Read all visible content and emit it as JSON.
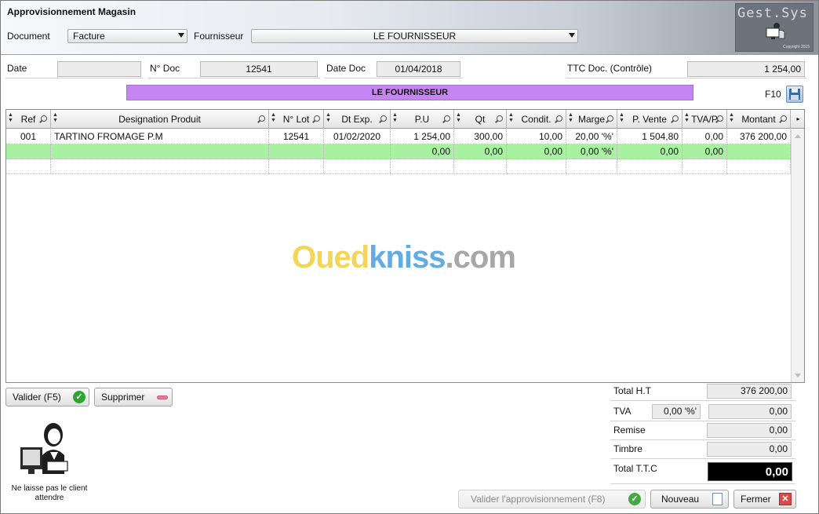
{
  "header": {
    "title": "Approvisionnement Magasin",
    "document_label": "Document",
    "document_value": "Facture",
    "fournisseur_label": "Fournisseur",
    "fournisseur_value": "LE FOURNISSEUR",
    "logo_text": "Gest.Sys",
    "logo_copyright": "Copyright 2015"
  },
  "fields": {
    "date_label": "Date",
    "date_value": "",
    "ndoc_label": "N° Doc",
    "ndoc_value": "12541",
    "datedoc_label": "Date Doc",
    "datedoc_value": "01/04/2018",
    "ttc_label": "TTC Doc. (Contrôle)",
    "ttc_value": "1 254,00"
  },
  "supplier_banner": "LE FOURNISSEUR",
  "f10_label": "F10",
  "grid": {
    "columns": [
      "Ref",
      "Designation Produit",
      "N° Lot",
      "Dt Exp.",
      "P.U",
      "Qt",
      "Condit.",
      "Marge",
      "P. Vente",
      "TVA/P",
      "Montant"
    ],
    "rows": [
      [
        "001",
        "TARTINO FROMAGE P.M",
        "12541",
        "01/02/2020",
        "1 254,00",
        "300,00",
        "10,00",
        "20,00 '%'",
        "1 504,80",
        "0,00",
        "376 200,00"
      ],
      [
        "",
        "",
        "",
        "",
        "0,00",
        "0,00",
        "0,00",
        "0,00 '%'",
        "0,00",
        "0,00",
        ""
      ]
    ]
  },
  "watermark": {
    "part1": "Oued",
    "part2": "kniss",
    "part3": ".com"
  },
  "buttons": {
    "valider": "Valider (F5)",
    "supprimer": "Supprimer",
    "valider_appro": "Valider l'approvisionnement (F8)",
    "nouveau": "Nouveau",
    "fermer": "Fermer"
  },
  "totals": {
    "total_ht_label": "Total H.T",
    "total_ht_value": "376 200,00",
    "tva_label": "TVA",
    "tva_rate": "0,00 '%'",
    "tva_value": "0,00",
    "remise_label": "Remise",
    "remise_value": "0,00",
    "timbre_label": "Timbre",
    "timbre_value": "0,00",
    "total_ttc_label": "Total T.T.C",
    "total_ttc_value": "0,00"
  },
  "person_caption": "Ne laisse pas le client attendre",
  "colors": {
    "supplier_banner": "#c585f2",
    "new_row": "#a7f1a0",
    "ttc_box": "#000000"
  }
}
